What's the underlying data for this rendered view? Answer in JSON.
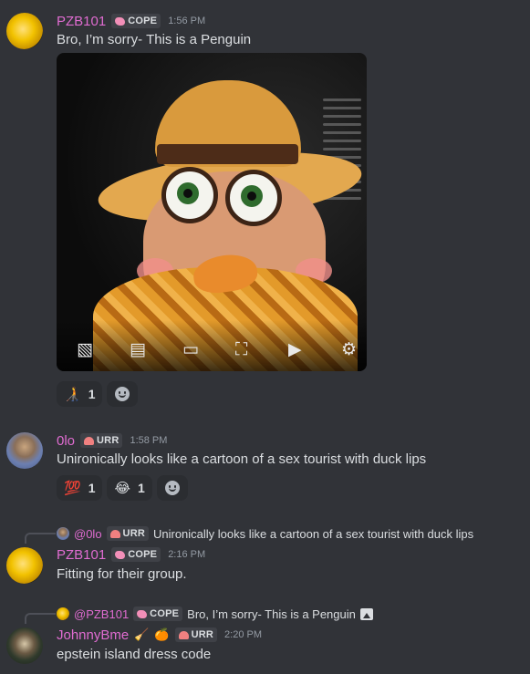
{
  "messages": [
    {
      "author": "PZB101",
      "tag": "COPE",
      "time": "1:56 PM",
      "text": "Bro, I’m sorry- This is a Penguin",
      "reactions": [
        {
          "emoji": "🧑‍🦯",
          "count": "1"
        }
      ]
    },
    {
      "author": "0lo",
      "tag": "URR",
      "time": "1:58 PM",
      "text": "Unironically looks like a cartoon of a sex tourist with duck lips",
      "reactions": [
        {
          "emoji": "💯",
          "count": "1"
        },
        {
          "emoji": "😂",
          "count": "1"
        }
      ]
    },
    {
      "reply": {
        "author": "@0lo",
        "tag": "URR",
        "text": "Unironically looks like a cartoon of a sex tourist with duck lips"
      },
      "author": "PZB101",
      "tag": "COPE",
      "time": "2:16 PM",
      "text": "Fitting for their group."
    },
    {
      "reply": {
        "author": "@PZB101",
        "tag": "COPE",
        "text": "Bro, I’m sorry- This is a Penguin"
      },
      "author": "JohnnyBme",
      "tag": "URR",
      "time": "2:20 PM",
      "text": "epstein island dress code",
      "name_emojis": [
        "🧹",
        "🍊"
      ]
    }
  ],
  "colors": {
    "username": "#e06cd1",
    "background": "#313338",
    "tag_bg": "#3f4147"
  }
}
